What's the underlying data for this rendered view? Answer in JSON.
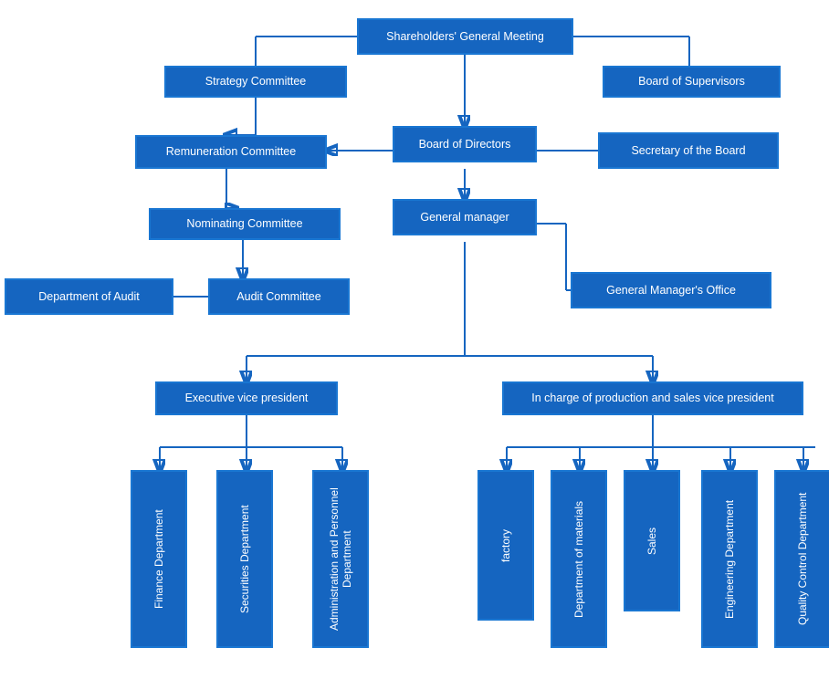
{
  "nodes": {
    "shareholders": {
      "label": "Shareholders' General Meeting"
    },
    "strategy": {
      "label": "Strategy Committee"
    },
    "board_supervisors": {
      "label": "Board of Supervisors"
    },
    "remuneration": {
      "label": "Remuneration Committee"
    },
    "board_directors": {
      "label": "Board of Directors"
    },
    "secretary": {
      "label": "Secretary of the Board"
    },
    "nominating": {
      "label": "Nominating Committee"
    },
    "general_manager": {
      "label": "General manager"
    },
    "dept_audit": {
      "label": "Department of Audit"
    },
    "audit_committee": {
      "label": "Audit Committee"
    },
    "gm_office": {
      "label": "General Manager's Office"
    },
    "exec_vp": {
      "label": "Executive vice president"
    },
    "production_vp": {
      "label": "In charge of production and sales vice president"
    },
    "finance": {
      "label": "Finance Department"
    },
    "securities": {
      "label": "Securities Department"
    },
    "admin": {
      "label": "Administration and Personnel Department"
    },
    "factory": {
      "label": "factory"
    },
    "materials": {
      "label": "Department of materials"
    },
    "sales": {
      "label": "Sales"
    },
    "engineering": {
      "label": "Engineering Department"
    },
    "quality": {
      "label": "Quality Control Department"
    }
  }
}
